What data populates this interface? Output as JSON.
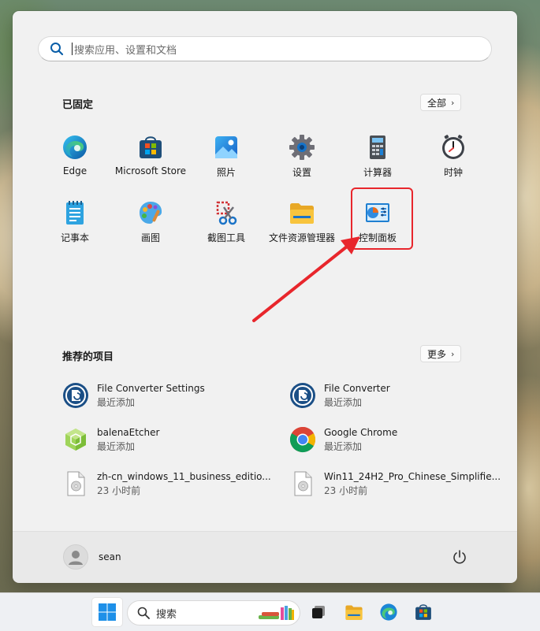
{
  "search": {
    "placeholder": "搜索应用、设置和文档"
  },
  "pinned": {
    "title": "已固定",
    "all_button": "全部",
    "apps": [
      {
        "label": "Edge",
        "icon": "edge-icon"
      },
      {
        "label": "Microsoft Store",
        "icon": "store-icon"
      },
      {
        "label": "照片",
        "icon": "photos-icon"
      },
      {
        "label": "设置",
        "icon": "settings-gear-icon"
      },
      {
        "label": "计算器",
        "icon": "calculator-icon"
      },
      {
        "label": "时钟",
        "icon": "clock-icon"
      },
      {
        "label": "记事本",
        "icon": "notepad-icon"
      },
      {
        "label": "画图",
        "icon": "paint-icon"
      },
      {
        "label": "截图工具",
        "icon": "snipping-tool-icon"
      },
      {
        "label": "文件资源管理器",
        "icon": "folder-icon"
      },
      {
        "label": "控制面板",
        "icon": "control-panel-icon"
      }
    ]
  },
  "recommended": {
    "title": "推荐的项目",
    "more_button": "更多",
    "items": [
      {
        "name": "File Converter Settings",
        "sub": "最近添加",
        "icon": "file-converter-icon"
      },
      {
        "name": "File Converter",
        "sub": "最近添加",
        "icon": "file-converter-icon"
      },
      {
        "name": "balenaEtcher",
        "sub": "最近添加",
        "icon": "balena-etcher-icon"
      },
      {
        "name": "Google Chrome",
        "sub": "最近添加",
        "icon": "chrome-icon"
      },
      {
        "name": "zh-cn_windows_11_business_editio...",
        "sub": "23 小时前",
        "icon": "disc-image-file-icon"
      },
      {
        "name": "Win11_24H2_Pro_Chinese_Simplifie...",
        "sub": "23 小时前",
        "icon": "disc-image-file-icon"
      }
    ]
  },
  "user": {
    "name": "sean"
  },
  "taskbar": {
    "search_label": "搜索"
  },
  "colors": {
    "highlight": "#e8262c",
    "accent": "#0067c0"
  }
}
